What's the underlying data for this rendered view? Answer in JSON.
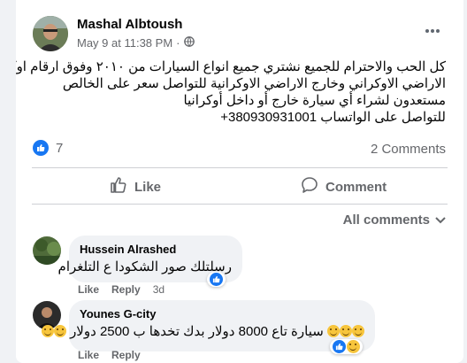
{
  "post": {
    "author": "Mashal Albtoush",
    "timestamp": "May 9 at 11:38 PM",
    "separator": "·",
    "text_lines": [
      "كل الحب والاحترام للجميع نشتري جميع انواع السيارات من ٢٠١٠ وفوق ارقام اوكرانيا داخل",
      "الاراضي الاوكراني وخارج الاراضي الاوكرانية للتواصل سعر على الخالص",
      "مستعدون لشراء أي سيارة خارج أو داخل أوكرانيا",
      "للتواصل على الواتساب 380930931001+"
    ],
    "reactions_count": "7",
    "comments_count": "2 Comments"
  },
  "actions": {
    "like_label": "Like",
    "comment_label": "Comment"
  },
  "comments_filter": "All comments",
  "comments": [
    {
      "name": "Hussein Alrashed",
      "text": "رسلتلك صور الشكودا ع التلغرام",
      "like": "Like",
      "reply": "Reply",
      "time": "3d"
    },
    {
      "name": "Younes G-city",
      "text": "سيارة تاع 8000 دولار بدك تخدها ب 2500 دولار",
      "like": "Like",
      "reply": "Reply",
      "time": ""
    }
  ],
  "colors": {
    "accent": "#1877f2",
    "secondary_text": "#65676b",
    "background": "#f0f2f5"
  }
}
